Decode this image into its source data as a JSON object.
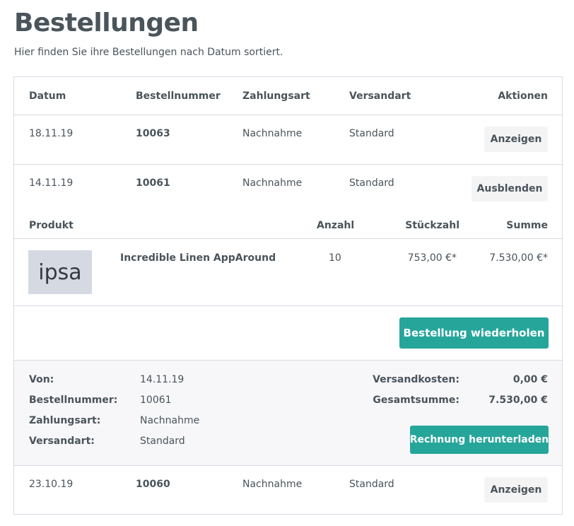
{
  "page": {
    "title": "Bestellungen",
    "subtitle": "Hier finden Sie ihre Bestellungen nach Datum sortiert."
  },
  "table": {
    "headers": {
      "date": "Datum",
      "order_number": "Bestellnummer",
      "payment": "Zahlungsart",
      "shipping": "Versandart",
      "actions": "Aktionen"
    },
    "orders": [
      {
        "date": "18.11.19",
        "number": "10063",
        "payment": "Nachnahme",
        "shipping": "Standard",
        "action": "Anzeigen"
      },
      {
        "date": "14.11.19",
        "number": "10061",
        "payment": "Nachnahme",
        "shipping": "Standard",
        "action": "Ausblenden"
      },
      {
        "date": "23.10.19",
        "number": "10060",
        "payment": "Nachnahme",
        "shipping": "Standard",
        "action": "Anzeigen"
      }
    ]
  },
  "detail": {
    "headers": {
      "product": "Produkt",
      "quantity": "Anzahl",
      "unit_price": "Stückzahl",
      "sum": "Summe"
    },
    "item": {
      "thumb_text": "ipsa",
      "name": "Incredible Linen AppAround",
      "quantity": "10",
      "unit_price": "753,00 €*",
      "sum": "7.530,00 €*"
    },
    "reorder_label": "Bestellung wiederholen",
    "summary": {
      "from_label": "Von:",
      "from_value": "14.11.19",
      "number_label": "Bestellnummer:",
      "number_value": "10061",
      "payment_label": "Zahlungsart:",
      "payment_value": "Nachnahme",
      "shipping_label": "Versandart:",
      "shipping_value": "Standard",
      "shipping_cost_label": "Versandkosten:",
      "shipping_cost_value": "0,00 €",
      "total_label": "Gesamtsumme:",
      "total_value": "7.530,00 €",
      "invoice_label": "Rechnung herunterladen"
    }
  },
  "colors": {
    "accent": "#26a69a",
    "text": "#4a545b",
    "border": "#dadae5",
    "button_light": "#f4f4f5",
    "summary_bg": "#f7f7f9"
  }
}
